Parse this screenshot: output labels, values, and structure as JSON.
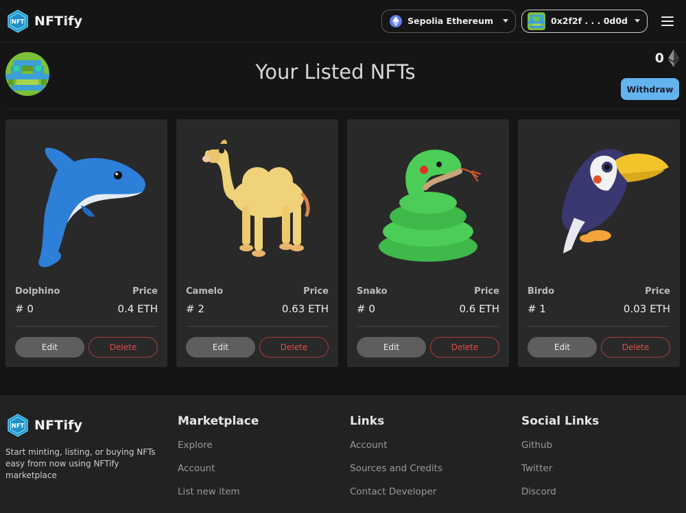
{
  "brand": {
    "name": "NFTify",
    "logo_text": "NFT"
  },
  "navbar": {
    "network_label": "Sepolia Ethereum",
    "account_label": "0x2f2f . . . 0d0d"
  },
  "header": {
    "title": "Your Listed NFTs",
    "balance": "0",
    "withdraw_label": "Withdraw"
  },
  "cards": [
    {
      "name": "Dolphino",
      "price_label": "Price",
      "id": "# 0",
      "price": "0.4 ETH",
      "edit": "Edit",
      "delete": "Delete",
      "image": "dolphin"
    },
    {
      "name": "Camelo",
      "price_label": "Price",
      "id": "# 2",
      "price": "0.63 ETH",
      "edit": "Edit",
      "delete": "Delete",
      "image": "camel"
    },
    {
      "name": "Snako",
      "price_label": "Price",
      "id": "# 0",
      "price": "0.6 ETH",
      "edit": "Edit",
      "delete": "Delete",
      "image": "snake"
    },
    {
      "name": "Birdo",
      "price_label": "Price",
      "id": "# 1",
      "price": "0.03 ETH",
      "edit": "Edit",
      "delete": "Delete",
      "image": "toucan"
    }
  ],
  "footer": {
    "brand_name": "NFTify",
    "description": "Start minting, listing, or buying NFTs easy from now using NFTify marketplace",
    "columns": [
      {
        "title": "Marketplace",
        "links": [
          "Explore",
          "Account",
          "List new item"
        ]
      },
      {
        "title": "Links",
        "links": [
          "Account",
          "Sources and Credits",
          "Contact Developer"
        ]
      },
      {
        "title": "Social Links",
        "links": [
          "Github",
          "Twitter",
          "Discord"
        ]
      }
    ]
  },
  "colors": {
    "accent": "#63b3ed",
    "danger": "#e0504a",
    "background": "#151515",
    "card": "#292929"
  }
}
